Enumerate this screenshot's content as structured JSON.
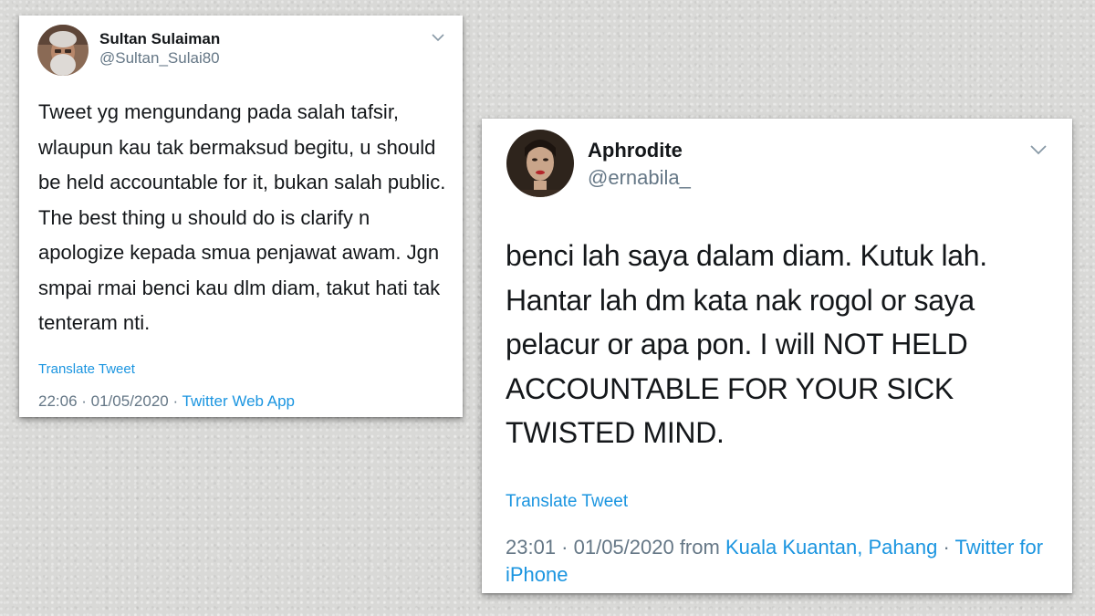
{
  "tweets": [
    {
      "name": "Sultan Sulaiman",
      "handle": "@Sultan_Sulai80",
      "text": "Tweet yg mengundang pada salah tafsir, wlaupun kau tak bermaksud begitu, u should be held accountable for it, bukan salah public. The best thing u should do is clarify n apologize kepada smua penjawat awam. Jgn smpai rmai benci kau dlm diam, takut hati tak tenteram nti.",
      "translate_label": "Translate Tweet",
      "time": "22:06 · 01/05/2020 · ",
      "source": "Twitter Web App"
    },
    {
      "name": "Aphrodite",
      "handle": "@ernabila_",
      "text": "benci lah saya dalam diam. Kutuk lah. Hantar lah dm kata nak rogol or saya pelacur or apa pon. I will NOT HELD ACCOUNTABLE FOR YOUR SICK TWISTED MIND.",
      "translate_label": "Translate Tweet",
      "time": "23:01 · 01/05/2020 from ",
      "location": "Kuala Kuantan, Pahang",
      "separator": " · ",
      "source": "Twitter for iPhone"
    }
  ],
  "colors": {
    "link": "#1b95e0",
    "muted": "#657786",
    "text": "#14171a"
  }
}
